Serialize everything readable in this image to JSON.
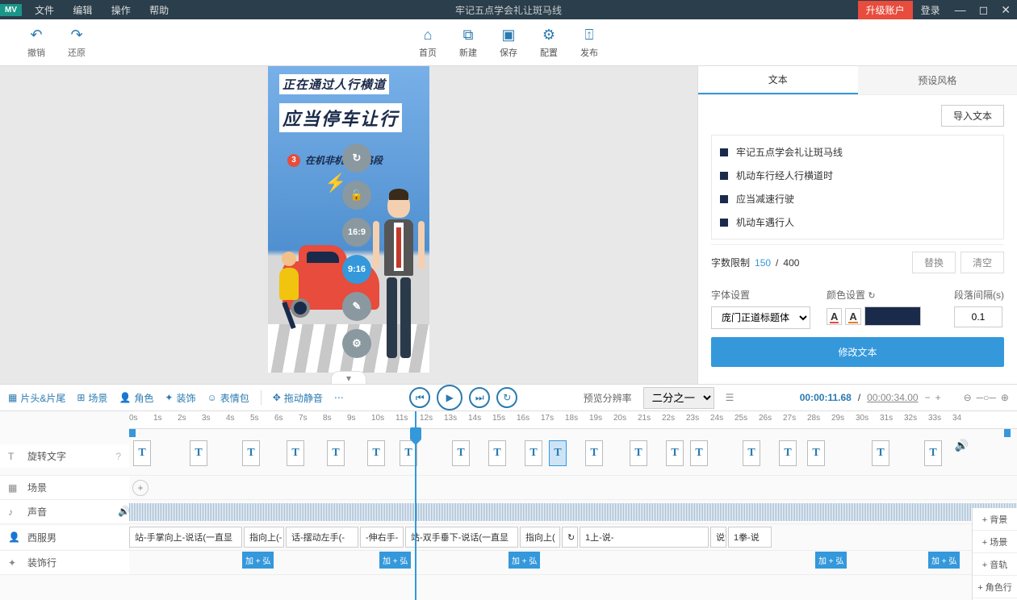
{
  "titlebar": {
    "logo": "MV",
    "menu": [
      "文件",
      "编辑",
      "操作",
      "帮助"
    ],
    "title": "牢记五点学会礼让斑马线",
    "upgrade": "升级账户",
    "login": "登录"
  },
  "toolbar": {
    "undo": "撤销",
    "redo": "还原",
    "home": "首页",
    "new": "新建",
    "save": "保存",
    "config": "配置",
    "publish": "发布"
  },
  "canvas": {
    "line1": "正在通过人行横道",
    "line2": "应当停车让行",
    "badge": "3",
    "line3": "在机非机混行路段"
  },
  "sideTools": {
    "refresh": "↻",
    "lock": "🔓",
    "r169": "16:9",
    "r916": "9:16",
    "edit": "✎",
    "settings": "⚙"
  },
  "rpanel": {
    "tabs": {
      "text": "文本",
      "preset": "预设风格"
    },
    "import": "导入文本",
    "items": [
      "牢记五点学会礼让斑马线",
      "机动车行经人行横道时",
      "应当减速行驶",
      "机动车遇行人"
    ],
    "limitLabel": "字数限制",
    "limitCur": "150",
    "limitSep": " /",
    "limitMax": "400",
    "replace": "替换",
    "clear": "清空",
    "fontLabel": "字体设置",
    "fontValue": "庞门正道标题体",
    "colorLabel": "颜色设置",
    "gapLabel": "段落间隔(s)",
    "gapValue": "0.1",
    "modify": "修改文本"
  },
  "timelineBar": {
    "items": [
      "片头&片尾",
      "场景",
      "角色",
      "装饰",
      "表情包",
      "拖动静音"
    ],
    "previewLabel": "预览分辨率",
    "previewValue": "二分之一",
    "cur": "00:00:11.68",
    "sep": "/",
    "tot": "00:00:34.00"
  },
  "ruler": [
    "0s",
    "1s",
    "2s",
    "3s",
    "4s",
    "5s",
    "6s",
    "7s",
    "8s",
    "9s",
    "10s",
    "11s",
    "12s",
    "13s",
    "14s",
    "15s",
    "16s",
    "17s",
    "18s",
    "19s",
    "20s",
    "21s",
    "22s",
    "23s",
    "24s",
    "25s",
    "26s",
    "27s",
    "28s",
    "29s",
    "30s",
    "31s",
    "32s",
    "33s",
    "34"
  ],
  "tracks": {
    "rotate": "旋转文字",
    "scene": "场景",
    "sound": "声音",
    "male": "西服男",
    "deco": "装饰行"
  },
  "clips": {
    "male": [
      "站-手掌向上-说话(一直显",
      "指向上(-",
      "话-摆动左手(-",
      "-伸右手-",
      "站-双手垂下-说话(一直显",
      "指向上(",
      "↻ 站-双手解说(一直显示)",
      "1上-说-",
      "说话-摆动右手(一",
      "1拳-说"
    ],
    "deco": [
      "加 + 弘",
      "加 + 弘",
      "加 + 弘",
      "加 + 弘",
      "加 + 弘"
    ]
  },
  "rightBtns": [
    "+ 背景",
    "+ 场景",
    "+ 音轨",
    "+ 角色行"
  ]
}
